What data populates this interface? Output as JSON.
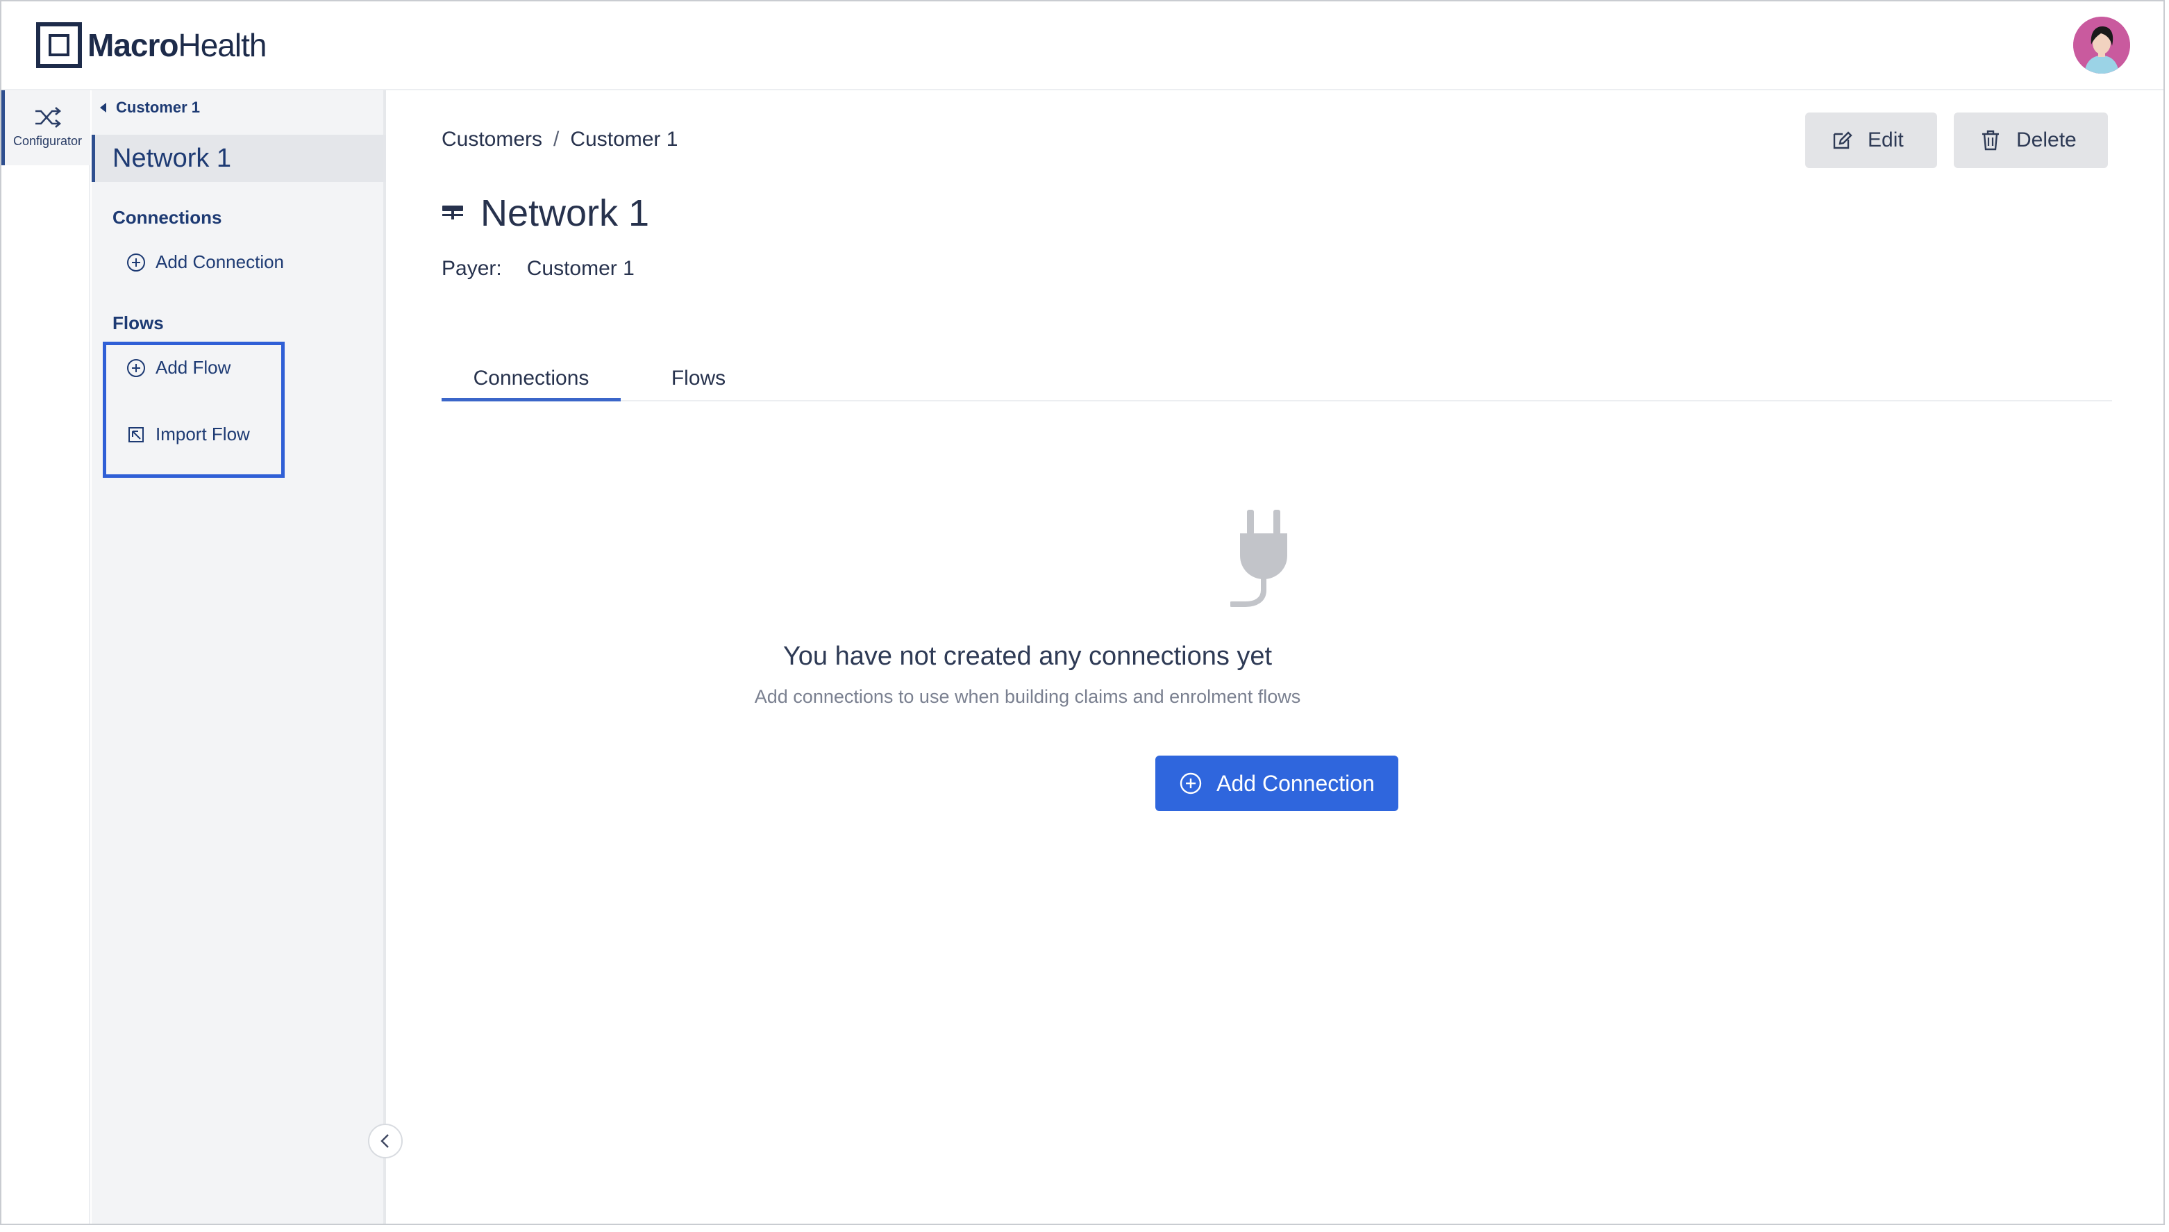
{
  "app": {
    "logo_bold": "Macro",
    "logo_rest": "Health"
  },
  "rail": {
    "configurator_label": "Configurator"
  },
  "sidebar": {
    "back_label": "Customer 1",
    "title": "Network 1",
    "connections_heading": "Connections",
    "add_connection_label": "Add Connection",
    "flows_heading": "Flows",
    "add_flow_label": "Add Flow",
    "import_flow_label": "Import Flow"
  },
  "main": {
    "breadcrumb": [
      "Customers",
      "/",
      "Customer 1"
    ],
    "edit_label": "Edit",
    "delete_label": "Delete",
    "title": "Network 1",
    "payer_label": "Payer:",
    "payer_value": "Customer 1",
    "tabs": [
      {
        "label": "Connections",
        "active": true
      },
      {
        "label": "Flows",
        "active": false
      }
    ],
    "empty_title": "You have not created any connections yet",
    "empty_subtitle": "Add connections to use when building claims and enrolment flows",
    "add_connection_button": "Add Connection"
  },
  "colors": {
    "accent": "#2f66dd",
    "nav_text": "#1d3a73",
    "highlight_border": "#2f5fd6"
  },
  "icons": [
    "shuffle-icon",
    "plus-circle-icon",
    "import-icon",
    "chevron-left-icon",
    "edit-icon",
    "trash-icon",
    "network-icon",
    "plug-icon",
    "avatar-icon"
  ]
}
